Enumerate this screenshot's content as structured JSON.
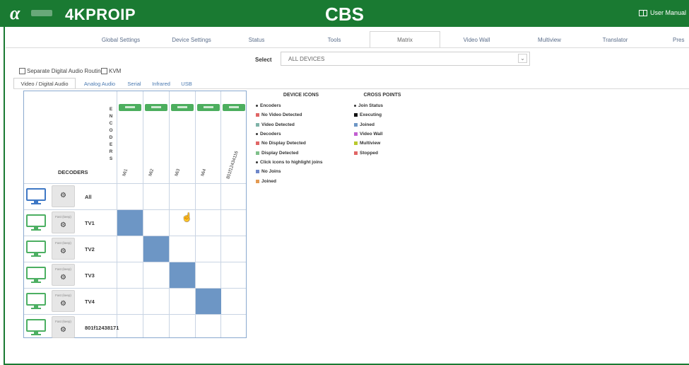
{
  "header": {
    "product": "4KPROIP",
    "site": "CBS",
    "manual": "User Manual",
    "accent": "#1a7a32"
  },
  "nav": [
    {
      "label": "Global Settings",
      "active": false
    },
    {
      "label": "Device Settings",
      "active": false
    },
    {
      "label": "Status",
      "active": false
    },
    {
      "label": "Tools",
      "active": false
    },
    {
      "label": "Matrix",
      "active": true
    },
    {
      "label": "Video Wall",
      "active": false
    },
    {
      "label": "Multiview",
      "active": false
    },
    {
      "label": "Translator",
      "active": false
    },
    {
      "label": "Pres",
      "active": false
    }
  ],
  "select": {
    "label": "Select",
    "value": "ALL DEVICES"
  },
  "checkboxes": [
    {
      "label": "Separate Digital Audio Routing",
      "checked": false
    },
    {
      "label": "KVM",
      "checked": false
    }
  ],
  "subtabs": [
    {
      "label": "Video / Digital Audio",
      "active": true
    },
    {
      "label": "Analog Audio",
      "active": false
    },
    {
      "label": "Serial",
      "active": false
    },
    {
      "label": "Infrared",
      "active": false
    },
    {
      "label": "USB",
      "active": false
    }
  ],
  "matrix": {
    "encoders_label": "ENCODERS",
    "decoders_label": "DECODERS",
    "encoders": [
      "Mi1",
      "Mi2",
      "Mi3",
      "Mi4",
      "801f12434116"
    ],
    "decoders": [
      {
        "name": "All",
        "mode": "",
        "all": true
      },
      {
        "name": "TV1",
        "mode": "Fast (keep)"
      },
      {
        "name": "TV2",
        "mode": "Fast (keep)"
      },
      {
        "name": "TV3",
        "mode": "Fast (keep)"
      },
      {
        "name": "TV4",
        "mode": "Fast (keep)"
      },
      {
        "name": "801f12438171",
        "mode": "Fast (keep)"
      }
    ],
    "joins": [
      [
        1,
        0
      ],
      [
        2,
        1
      ],
      [
        3,
        2
      ],
      [
        4,
        3
      ]
    ],
    "join_color": "#6d96c5"
  },
  "legend_device": {
    "title": "DEVICE ICONS",
    "items": [
      {
        "label": "Encoders",
        "marker": "dot"
      },
      {
        "label": "No Video Detected",
        "color": "#e06666"
      },
      {
        "label": "Video Detected",
        "color": "#7fb3a8"
      },
      {
        "label": "Decoders",
        "marker": "dot"
      },
      {
        "label": "No Display Detected",
        "color": "#e06666"
      },
      {
        "label": "Display Detected",
        "color": "#7fc08a"
      },
      {
        "label": "Click icons to highlight joins",
        "marker": "dot"
      },
      {
        "label": "No Joins",
        "color": "#6f87c9"
      },
      {
        "label": "Joined",
        "color": "#e39a53"
      }
    ]
  },
  "legend_cross": {
    "title": "CROSS POINTS",
    "items": [
      {
        "label": "Join Status",
        "marker": "dot"
      },
      {
        "label": "Executing",
        "color": "#111111"
      },
      {
        "label": "Joined",
        "color": "#6d96c5"
      },
      {
        "label": "Video Wall",
        "color": "#c25fd1"
      },
      {
        "label": "Multiview",
        "color": "#b9c92e"
      },
      {
        "label": "Stopped",
        "color": "#e06666"
      }
    ]
  }
}
